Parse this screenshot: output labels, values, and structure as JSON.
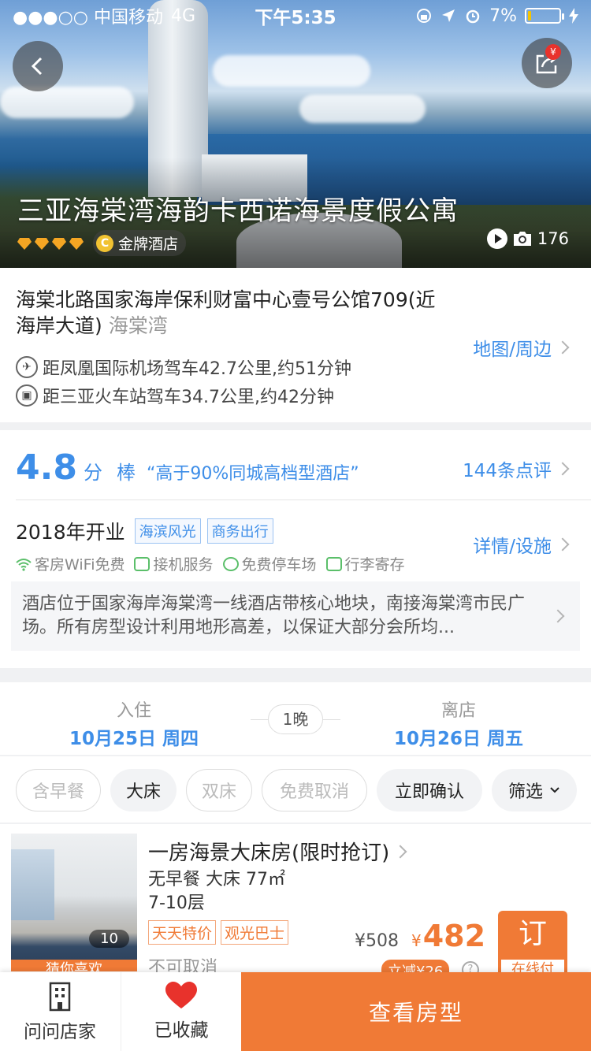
{
  "status_bar": {
    "carrier": "●●●○○ 中国移动",
    "network": "4G",
    "time": "下午5:35",
    "battery": "7%"
  },
  "hero": {
    "hotel_name": "三亚海棠湾海韵卡西诺海景度假公寓",
    "diamond_count": 4,
    "gold_badge": "金牌酒店",
    "photo_count": "176",
    "share_badge": "¥"
  },
  "address": {
    "line": "海棠北路国家海岸保利财富中心壹号公馆709(近海岸大道)",
    "area": "海棠湾",
    "map_link": "地图/周边",
    "airport": "距凤凰国际机场驾车42.7公里,约51分钟",
    "train": "距三亚火车站驾车34.7公里,约42分钟"
  },
  "rating": {
    "score": "4.8",
    "unit": "分",
    "word": "棒",
    "quote": "“高于90%同城高档型酒店”",
    "review_link": "144条点评"
  },
  "info": {
    "opened": "2018年开业",
    "tags": [
      "海滨风光",
      "商务出行"
    ],
    "detail_link": "详情/设施",
    "facilities": [
      "客房WiFi免费",
      "接机服务",
      "免费停车场",
      "行李寄存"
    ],
    "description": "酒店位于国家海岸海棠湾一线酒店带核心地块，南接海棠湾市民广场。所有房型设计利用地形高差，以保证大部分会所均..."
  },
  "dates": {
    "checkin_label": "入住",
    "checkin_value": "10月25日 周四",
    "nights": "1晚",
    "checkout_label": "离店",
    "checkout_value": "10月26日 周五"
  },
  "filters": {
    "breakfast": "含早餐",
    "king": "大床",
    "twin": "双床",
    "free_cancel": "免费取消",
    "instant": "立即确认",
    "filter": "筛选"
  },
  "room": {
    "title": "一房海景大床房(限时抢订)",
    "spec_line1": "无早餐 大床  77㎡",
    "spec_line2": "7-10层",
    "tags": [
      "天天特价",
      "观光巴士"
    ],
    "cancel": "不可取消",
    "photo_count": "10",
    "photo_label": "猜你喜欢",
    "original_price": "¥508",
    "currency": "¥",
    "price": "482",
    "discount": "立减¥26",
    "book_label": "订",
    "pay_label": "在线付"
  },
  "bottom_bar": {
    "ask": "问问店家",
    "saved": "已收藏",
    "cta": "查看房型"
  },
  "colors": {
    "accent_blue": "#3e8ee8",
    "accent_orange": "#f07a36",
    "favorite_red": "#e8322c"
  }
}
